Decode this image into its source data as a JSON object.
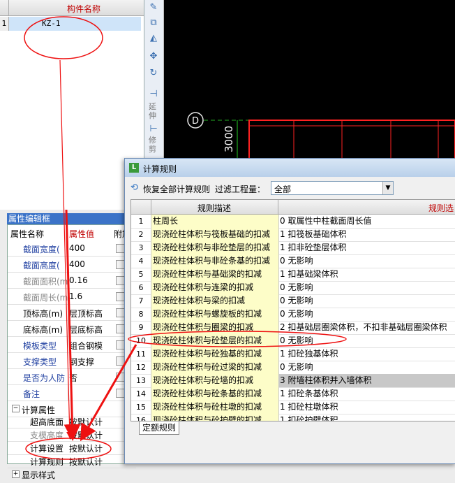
{
  "component_list": {
    "header": "构件名称",
    "rows": [
      {
        "num": "1",
        "name": "KZ-1"
      }
    ]
  },
  "toolbar": {
    "labels": [
      "延伸",
      "修剪"
    ]
  },
  "cad": {
    "axis_label": "D",
    "dimension": "3000"
  },
  "property_editor": {
    "title": "属性编辑框",
    "col_name": "属性名称",
    "col_value": "属性值",
    "col_extra": "附加",
    "rows": [
      {
        "name": "截面宽度(",
        "value": "400",
        "color": "#1f3fa0"
      },
      {
        "name": "截面高度(",
        "value": "400",
        "color": "#1f3fa0"
      },
      {
        "name": "截面面积(m",
        "value": "0.16",
        "color": "#888888"
      },
      {
        "name": "截面周长(m",
        "value": "1.6",
        "color": "#888888"
      },
      {
        "name": "顶标高(m)",
        "value": "层顶标高",
        "color": "#000000"
      },
      {
        "name": "底标高(m)",
        "value": "层底标高",
        "color": "#000000"
      },
      {
        "name": "模板类型",
        "value": "组合钢模",
        "color": "#1f3fa0"
      },
      {
        "name": "支撑类型",
        "value": "钢支撑",
        "color": "#1f3fa0"
      },
      {
        "name": "是否为人防",
        "value": "否",
        "color": "#1f3fa0"
      },
      {
        "name": "备注",
        "value": "",
        "color": "#1f3fa0"
      }
    ],
    "group": {
      "name": "计算属性",
      "toggle": "−",
      "items": [
        {
          "name": "超高底面",
          "value": "按默认计"
        },
        {
          "name": "支模高度",
          "value": "按默认计"
        },
        {
          "name": "计算设置",
          "value": "按默认计"
        },
        {
          "name": "计算规则",
          "value": "按默认计"
        }
      ]
    },
    "group2": {
      "name": "显示样式",
      "toggle": "+"
    }
  },
  "dialog": {
    "title": "计算规则",
    "restore_label": "恢复全部计算规则",
    "filter_label": "过滤工程量：",
    "filter_value": "全部",
    "col_desc": "规则描述",
    "col_rule": "规则选",
    "rows": [
      {
        "n": "1",
        "desc": "柱周长",
        "rule": "0 取属性中柱截面周长值"
      },
      {
        "n": "2",
        "desc": "现浇砼柱体积与筏板基础的扣减",
        "rule": "1 扣筏板基础体积"
      },
      {
        "n": "3",
        "desc": "现浇砼柱体积与非砼垫层的扣减",
        "rule": "1 扣非砼垫层体积"
      },
      {
        "n": "4",
        "desc": "现浇砼柱体积与非砼条基的扣减",
        "rule": "0 无影响"
      },
      {
        "n": "5",
        "desc": "现浇砼柱体积与基础梁的扣减",
        "rule": "1 扣基础梁体积"
      },
      {
        "n": "6",
        "desc": "现浇砼柱体积与连梁的扣减",
        "rule": "0 无影响"
      },
      {
        "n": "7",
        "desc": "现浇砼柱体积与梁的扣减",
        "rule": "0 无影响"
      },
      {
        "n": "8",
        "desc": "现浇砼柱体积与螺旋板的扣减",
        "rule": "0 无影响"
      },
      {
        "n": "9",
        "desc": "现浇砼柱体积与圈梁的扣减",
        "rule": "2 扣基础层圈梁体积，不扣非基础层圈梁体积"
      },
      {
        "n": "10",
        "desc": "现浇砼柱体积与砼垫层的扣减",
        "rule": "0 无影响"
      },
      {
        "n": "11",
        "desc": "现浇砼柱体积与砼独基的扣减",
        "rule": "1 扣砼独基体积"
      },
      {
        "n": "12",
        "desc": "现浇砼柱体积与砼过梁的扣减",
        "rule": "0 无影响"
      },
      {
        "n": "13",
        "desc": "现浇砼柱体积与砼墙的扣减",
        "rule": "3 附墙柱体积并入墙体积"
      },
      {
        "n": "14",
        "desc": "现浇砼柱体积与砼条基的扣减",
        "rule": "1 扣砼条基体积"
      },
      {
        "n": "15",
        "desc": "现浇砼柱体积与砼柱墩的扣减",
        "rule": "1 扣砼柱墩体积"
      },
      {
        "n": "16",
        "desc": "现浇砼柱体积与砼护壁的扣减",
        "rule": "1 扣砼护壁体积"
      }
    ],
    "tab": "定额规则"
  },
  "colors": {
    "annotation": "#ee1111",
    "selected_row": "#cfe4f9",
    "desc_cell": "#fdfdc8",
    "title_bar": "#3b73c8"
  }
}
